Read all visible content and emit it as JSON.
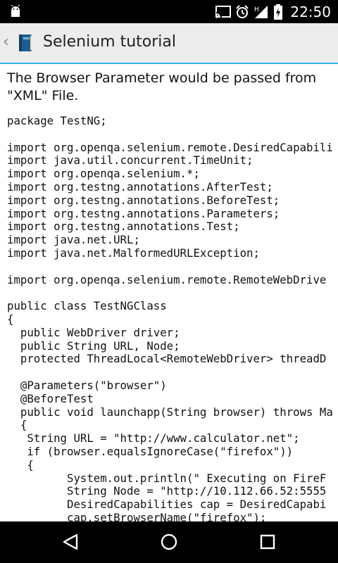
{
  "status_bar": {
    "time": "22:50",
    "icons": [
      "android-debug-icon",
      "cast-icon",
      "alarm-icon",
      "signal-h-icon",
      "battery-charging-icon"
    ]
  },
  "app_bar": {
    "title": "Selenium tutorial"
  },
  "content": {
    "intro": "The Browser Parameter would be passed from \"XML\" File.",
    "code_lines": [
      "package TestNG;",
      "",
      "import org.openqa.selenium.remote.DesiredCapabili",
      "import java.util.concurrent.TimeUnit;",
      "import org.openqa.selenium.*;",
      "import org.testng.annotations.AfterTest;",
      "import org.testng.annotations.BeforeTest;",
      "import org.testng.annotations.Parameters;",
      "import org.testng.annotations.Test;",
      "import java.net.URL;",
      "import java.net.MalformedURLException;",
      "",
      "import org.openqa.selenium.remote.RemoteWebDrive",
      "",
      "public class TestNGClass",
      "{",
      "  public WebDriver driver;",
      "  public String URL, Node;",
      "  protected ThreadLocal<RemoteWebDriver> threadD",
      "",
      "  @Parameters(\"browser\")",
      "  @BeforeTest",
      "  public void launchapp(String browser) throws Ma",
      "  {",
      "   String URL = \"http://www.calculator.net\";",
      "   if (browser.equalsIgnoreCase(\"firefox\"))",
      "   {",
      "         System.out.println(\" Executing on FireF",
      "         String Node = \"http://10.112.66.52:5555",
      "         DesiredCapabilities cap = DesiredCapabi",
      "         cap.setBrowserName(\"firefox\");"
    ]
  },
  "nav_bar": {
    "buttons": [
      "back-nav-icon",
      "home-nav-icon",
      "recents-nav-icon"
    ]
  }
}
